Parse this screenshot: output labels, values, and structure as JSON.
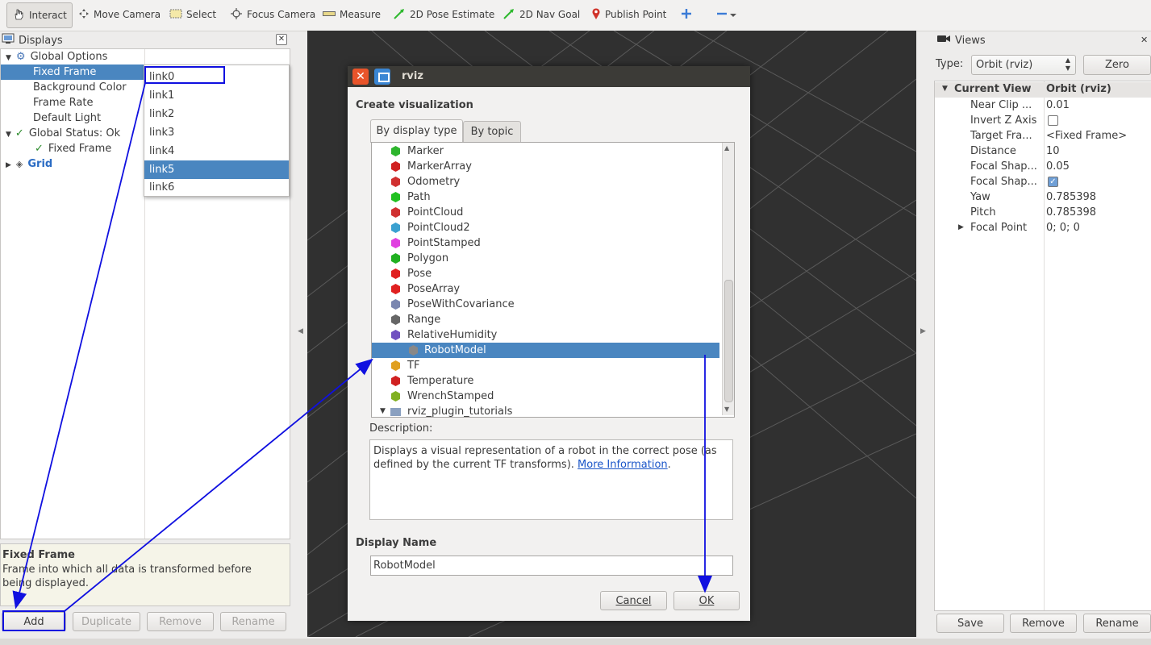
{
  "toolbar": {
    "tools": [
      {
        "label": "Interact",
        "icon": "hand-pointer-icon"
      },
      {
        "label": "Move Camera",
        "icon": "move-camera-icon"
      },
      {
        "label": "Select",
        "icon": "select-icon"
      },
      {
        "label": "Focus Camera",
        "icon": "focus-camera-icon"
      },
      {
        "label": "Measure",
        "icon": "ruler-icon"
      },
      {
        "label": "2D Pose Estimate",
        "icon": "pose-estimate-arrow-icon"
      },
      {
        "label": "2D Nav Goal",
        "icon": "nav-goal-arrow-icon"
      },
      {
        "label": "Publish Point",
        "icon": "map-pin-icon"
      }
    ]
  },
  "displays": {
    "title": "Displays",
    "tree": [
      {
        "label": "Global Options"
      },
      {
        "label": "Fixed Frame"
      },
      {
        "label": "Background Color"
      },
      {
        "label": "Frame Rate"
      },
      {
        "label": "Default Light"
      },
      {
        "label": "Global Status: Ok"
      },
      {
        "label": "Fixed Frame"
      },
      {
        "label": "Grid"
      }
    ],
    "dropdown": [
      "link0",
      "link1",
      "link2",
      "link3",
      "link4",
      "link5",
      "link6"
    ],
    "dropdown_selected": "link5",
    "help_title": "Fixed Frame",
    "help_text": "Frame into which all data is transformed before being displayed.",
    "buttons": {
      "add": "Add",
      "duplicate": "Duplicate",
      "remove": "Remove",
      "rename": "Rename"
    }
  },
  "dialog": {
    "title": "rviz",
    "heading": "Create visualization",
    "tabs": {
      "by_type": "By display type",
      "by_topic": "By topic"
    },
    "items": [
      {
        "label": "Marker",
        "color": "#2db52d"
      },
      {
        "label": "MarkerArray",
        "color": "#d02020"
      },
      {
        "label": "Odometry",
        "color": "#d03030"
      },
      {
        "label": "Path",
        "color": "#20c020"
      },
      {
        "label": "PointCloud",
        "color": "#d03030"
      },
      {
        "label": "PointCloud2",
        "color": "#3aa0d0"
      },
      {
        "label": "PointStamped",
        "color": "#e040e0"
      },
      {
        "label": "Polygon",
        "color": "#20b020"
      },
      {
        "label": "Pose",
        "color": "#e02020"
      },
      {
        "label": "PoseArray",
        "color": "#e02020"
      },
      {
        "label": "PoseWithCovariance",
        "color": "#7a86b0"
      },
      {
        "label": "Range",
        "color": "#666666"
      },
      {
        "label": "RelativeHumidity",
        "color": "#7050c0"
      },
      {
        "label": "RobotModel",
        "color": "#888888"
      },
      {
        "label": "TF",
        "color": "#e0a020"
      },
      {
        "label": "Temperature",
        "color": "#d02020"
      },
      {
        "label": "WrenchStamped",
        "color": "#80b020"
      },
      {
        "label": "rviz_plugin_tutorials",
        "color": "#8aa0c0"
      }
    ],
    "selected": "RobotModel",
    "description_label": "Description:",
    "description_text": "Displays a visual representation of a robot in the correct pose (as defined by the current TF transforms).",
    "more_info": "More Information",
    "more_info_suffix": ".",
    "display_name_label": "Display Name",
    "display_name_value": "RobotModel",
    "cancel": "Cancel",
    "ok": "OK"
  },
  "views": {
    "title": "Views",
    "type_label": "Type:",
    "type_value": "Orbit (rviz)",
    "zero": "Zero",
    "header": {
      "key": "Current View",
      "value": "Orbit (rviz)"
    },
    "props": [
      {
        "key": "Near Clip ...",
        "value": "0.01"
      },
      {
        "key": "Invert Z Axis",
        "value": ""
      },
      {
        "key": "Target Fra...",
        "value": "<Fixed Frame>"
      },
      {
        "key": "Distance",
        "value": "10"
      },
      {
        "key": "Focal Shap...",
        "value": "0.05"
      },
      {
        "key": "Focal Shap...",
        "value": ""
      },
      {
        "key": "Yaw",
        "value": "0.785398"
      },
      {
        "key": "Pitch",
        "value": "0.785398"
      },
      {
        "key": "Focal Point",
        "value": "0; 0; 0"
      }
    ],
    "invert_z_checked": false,
    "focal_shape_checked": true,
    "buttons": {
      "save": "Save",
      "remove": "Remove",
      "rename": "Rename"
    }
  }
}
